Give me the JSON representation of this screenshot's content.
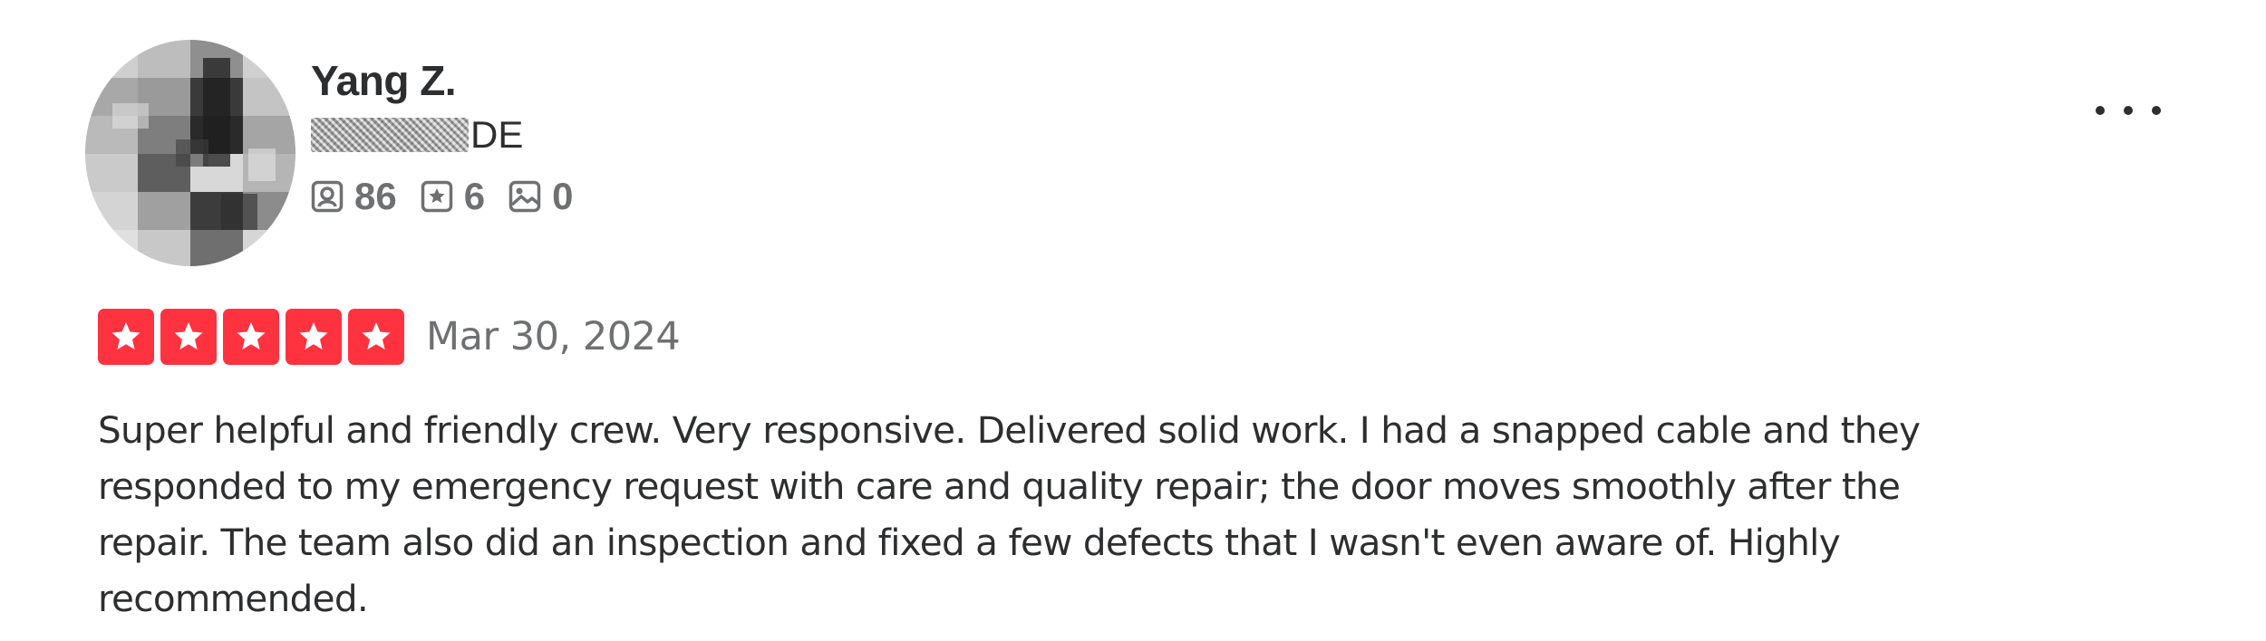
{
  "review": {
    "user": {
      "name": "Yang Z.",
      "location_country": "DE",
      "stats": {
        "reviews": "86",
        "friends": "6",
        "photos": "0"
      }
    },
    "rating": 5,
    "date": "Mar 30, 2024",
    "text": "Super helpful and friendly crew. Very responsive. Delivered solid work. I had a snapped cable and they responded to my emergency request with care and quality repair; the door moves smoothly after the repair. The team also did an inspection and fixed a few defects that I wasn't even aware of. Highly recommended."
  },
  "icons": {
    "stat_reviews": "review-icon",
    "stat_friends": "star-badge-icon",
    "stat_photos": "photo-icon",
    "more": "more-horizontal-icon",
    "star": "star-icon"
  },
  "colors": {
    "star_background": "#ff333f",
    "text_primary": "#2d2e2f",
    "text_secondary": "#6e7072"
  }
}
